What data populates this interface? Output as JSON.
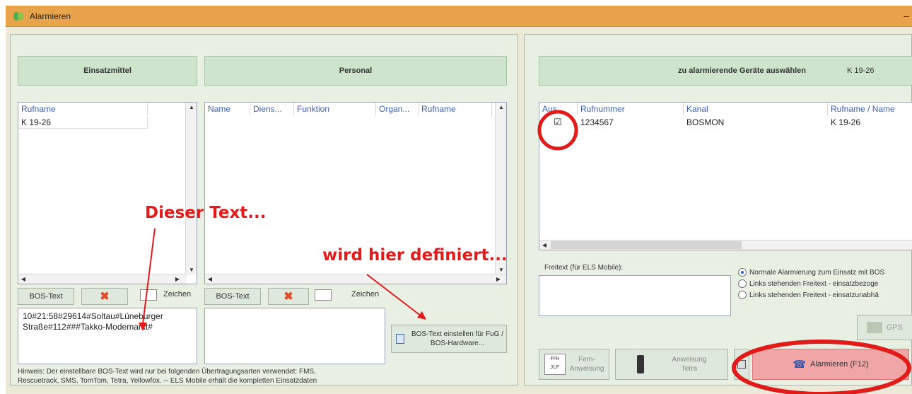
{
  "window": {
    "title": "Alarmieren",
    "minimize_glyph": "–"
  },
  "left": {
    "einsatzmittel": {
      "header": "Einsatzmittel",
      "columns": [
        "Rufname"
      ],
      "rows": [
        "K 19-26"
      ]
    },
    "personal": {
      "header": "Personal",
      "columns": [
        "Name",
        "Diens...",
        "Funktion",
        "Organ...",
        "Rufname"
      ]
    },
    "bos1": {
      "tab_label": "BOS-Text",
      "zeichen_label": "Zeichen",
      "text": "10#21:58#29614#Soltau#Lüneburger Straße#112###Takko-Modemarkt#"
    },
    "bos2": {
      "tab_label": "BOS-Text",
      "zeichen_label": "Zeichen",
      "text": ""
    },
    "bos_config_button": "BOS-Text einstellen für FuG / BOS-Hardware...",
    "hint_line1": "Hinweis: Der einstellbare BOS-Text wird nur bei folgenden Übertragungsarten verwendet: FMS,",
    "hint_line2": "Rescuetrack, SMS, TomTom, Tetra, Yellowfox. -- ELS Mobile erhält die kompletten Einsatzdaten"
  },
  "annotations": {
    "dieser_text": "Dieser Text...",
    "wird_hier": "wird hier definiert...",
    "color": "#e11a1a"
  },
  "right": {
    "header": "zu alarmierende Geräte auswählen",
    "header_unit": "K 19-26",
    "columns": [
      "Aus...",
      "Rufnummer",
      "Kanal",
      "Rufname / Name"
    ],
    "rows": [
      {
        "checked": "☑",
        "rufnummer": "1234567",
        "kanal": "BOSMON",
        "rufname": "K 19-26"
      }
    ],
    "freitext_label": "Freitext (für ELS Mobile):",
    "radio_options": [
      "Normale Alarmierung zum Einsatz mit BOS",
      "Links stehenden Freitext - einsatzbezoge",
      "Links stehenden Freitext - einsatzunabhä"
    ],
    "gps_label": "GPS",
    "buttons": {
      "fern_line1": "Fern-",
      "fern_line2": "Anweisung",
      "fern_icon_text_1": "FFH",
      "fern_icon_text_2": "JLP",
      "tetra_line1": "Anweisung",
      "tetra_line2": "Tetra",
      "alarm": "Alarmieren (F12)"
    }
  },
  "colors": {
    "titlebar": "#e9a44b",
    "panel_bg": "#e8f0e4",
    "group_header_bg": "#cfe4cc",
    "column_header_text": "#3c5fb0",
    "alarm_button_bg": "#f0a6a6"
  }
}
